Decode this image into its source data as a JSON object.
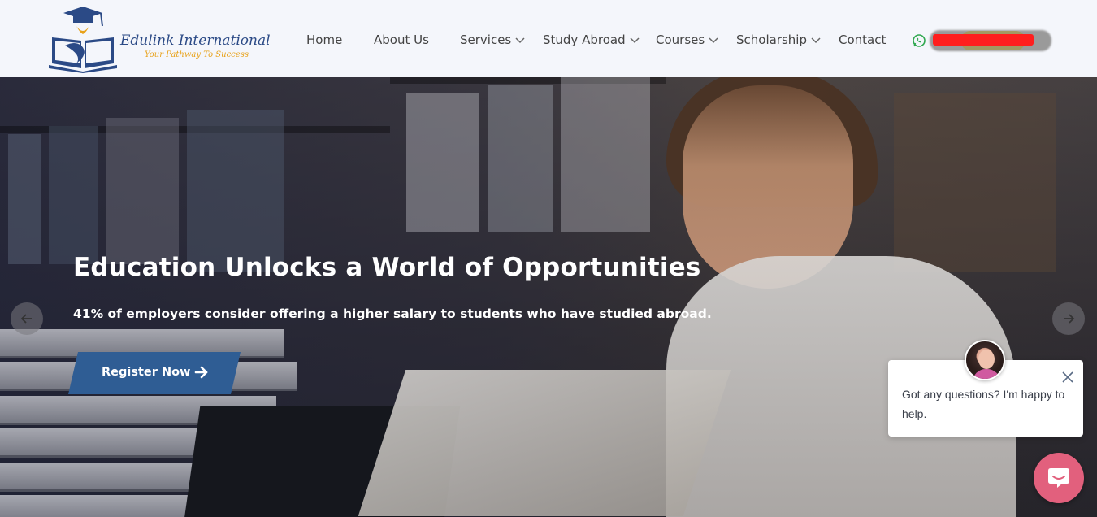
{
  "brand": {
    "name": "Edulink International",
    "tagline": "Your Pathway To Success"
  },
  "nav": {
    "items": [
      {
        "label": "Home",
        "has_dropdown": false
      },
      {
        "label": "About Us",
        "has_dropdown": false
      },
      {
        "label": "Services",
        "has_dropdown": true
      },
      {
        "label": "Study Abroad",
        "has_dropdown": true
      },
      {
        "label": "Courses",
        "has_dropdown": true
      },
      {
        "label": "Scholarship",
        "has_dropdown": true
      },
      {
        "label": "Contact",
        "has_dropdown": false
      }
    ],
    "contact_icon": "whatsapp-icon"
  },
  "hero": {
    "title": "Education Unlocks a World of Opportunities",
    "subtitle": "41% of employers consider offering a higher salary to students who have studied abroad.",
    "cta_label": "Register Now",
    "cta_icon": "arrow-right-icon",
    "prev_icon": "arrow-left-icon",
    "next_icon": "arrow-right-icon"
  },
  "chat": {
    "message": "Got any questions? I'm happy to help.",
    "close_icon": "close-icon",
    "launcher_icon": "chat-bubble-icon",
    "accent_color": "#e2607d"
  },
  "colors": {
    "brand_blue": "#2b4a86",
    "brand_gold": "#e8a21a",
    "cta_blue": "#2f5d94",
    "header_bg": "#f4f6fb"
  }
}
